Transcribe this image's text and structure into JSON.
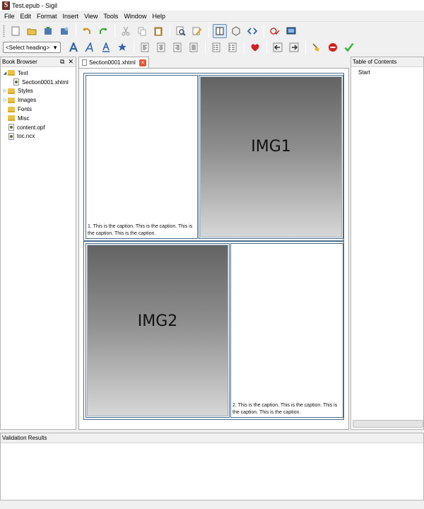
{
  "window": {
    "title": "Test.epub - Sigil"
  },
  "menu": [
    {
      "label": "File"
    },
    {
      "label": "Edit"
    },
    {
      "label": "Format"
    },
    {
      "label": "Insert"
    },
    {
      "label": "View"
    },
    {
      "label": "Tools"
    },
    {
      "label": "Window"
    },
    {
      "label": "Help"
    }
  ],
  "toolbar": {
    "heading_select": "<Select heading>"
  },
  "book_browser": {
    "title": "Book Browser",
    "items": [
      {
        "label": "Text",
        "level": 0,
        "kind": "folder",
        "expanded": true
      },
      {
        "label": "Section0001.xhtml",
        "level": 1,
        "kind": "file"
      },
      {
        "label": "Styles",
        "level": 0,
        "kind": "folder",
        "expanded": false
      },
      {
        "label": "Images",
        "level": 0,
        "kind": "folder",
        "expanded": false
      },
      {
        "label": "Fonts",
        "level": 0,
        "kind": "folder"
      },
      {
        "label": "Misc",
        "level": 0,
        "kind": "folder"
      },
      {
        "label": "content.opf",
        "level": 0,
        "kind": "file"
      },
      {
        "label": "toc.ncx",
        "level": 0,
        "kind": "file"
      }
    ]
  },
  "editor": {
    "tab_label": "Section0001.xhtml",
    "img1_label": "IMG1",
    "img2_label": "IMG2",
    "caption1": "1. This is the caption. This is the caption. This is the caption. This is the caption.",
    "caption2": "2. This is the caption. This is the caption. This is the caption. This is the caption."
  },
  "toc": {
    "title": "Table of Contents",
    "items": [
      {
        "label": "Start"
      }
    ]
  },
  "validation": {
    "title": "Validation Results"
  },
  "colors": {
    "table_border": "#4a6d8c",
    "accent": "#6b8bb5"
  }
}
